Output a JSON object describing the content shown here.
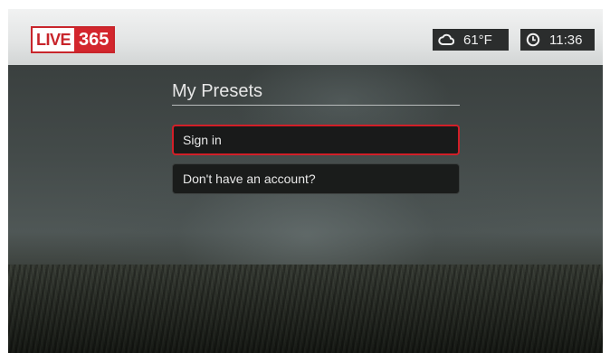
{
  "logo": {
    "text_live": "LIVE",
    "text_number": "365",
    "accent_color": "#d3262d"
  },
  "status_bar": {
    "weather": {
      "icon": "cloud-icon",
      "temperature": "61°F"
    },
    "clock": {
      "icon": "clock-icon",
      "time": "11:36"
    }
  },
  "page": {
    "title": "My Presets"
  },
  "menu": {
    "items": [
      {
        "label": "Sign in",
        "selected": true
      },
      {
        "label": "Don't have an account?",
        "selected": false
      }
    ],
    "selection_color": "#d21f28"
  }
}
